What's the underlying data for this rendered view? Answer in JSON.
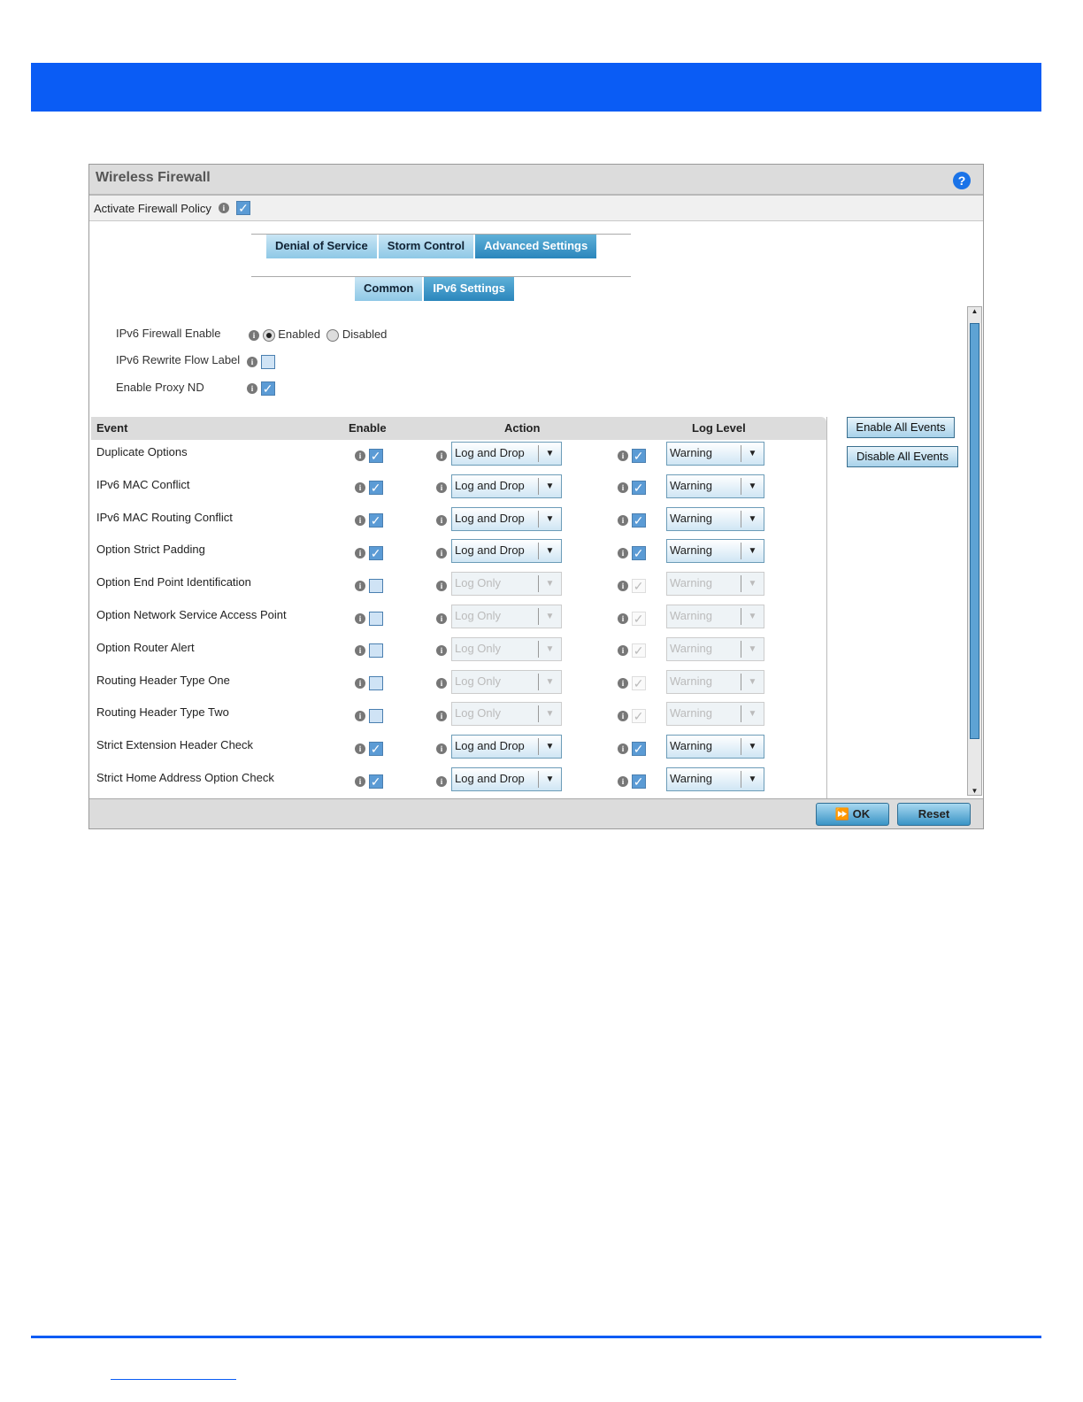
{
  "panel": {
    "title": "Wireless Firewall",
    "help": "?",
    "activate_label": "Activate Firewall Policy",
    "activate_checked": true
  },
  "tabs": [
    "Denial of Service",
    "Storm Control",
    "Advanced Settings"
  ],
  "subtabs": [
    "Common",
    "IPv6 Settings"
  ],
  "settings": {
    "fw_enable_label": "IPv6 Firewall Enable",
    "enabled": "Enabled",
    "disabled": "Disabled",
    "rewrite_label": "IPv6 Rewrite Flow Label",
    "proxy_label": "Enable Proxy ND"
  },
  "table": {
    "headers": [
      "Event",
      "Enable",
      "Action",
      "Log Level"
    ],
    "rows": [
      {
        "event": "Duplicate Options",
        "enabled": true,
        "action": "Log and Drop",
        "log": true,
        "level": "Warning"
      },
      {
        "event": "IPv6 MAC Conflict",
        "enabled": true,
        "action": "Log and Drop",
        "log": true,
        "level": "Warning"
      },
      {
        "event": "IPv6 MAC Routing Conflict",
        "enabled": true,
        "action": "Log and Drop",
        "log": true,
        "level": "Warning"
      },
      {
        "event": "Option Strict Padding",
        "enabled": true,
        "action": "Log and Drop",
        "log": true,
        "level": "Warning"
      },
      {
        "event": "Option End Point Identification",
        "enabled": false,
        "action": "Log Only",
        "log": true,
        "level": "Warning"
      },
      {
        "event": "Option Network Service Access Point",
        "enabled": false,
        "action": "Log Only",
        "log": true,
        "level": "Warning"
      },
      {
        "event": "Option Router Alert",
        "enabled": false,
        "action": "Log Only",
        "log": true,
        "level": "Warning"
      },
      {
        "event": "Routing Header Type One",
        "enabled": false,
        "action": "Log Only",
        "log": true,
        "level": "Warning"
      },
      {
        "event": "Routing Header Type Two",
        "enabled": false,
        "action": "Log Only",
        "log": true,
        "level": "Warning"
      },
      {
        "event": "Strict Extension Header Check",
        "enabled": true,
        "action": "Log and Drop",
        "log": true,
        "level": "Warning"
      },
      {
        "event": "Strict Home Address Option Check",
        "enabled": true,
        "action": "Log and Drop",
        "log": true,
        "level": "Warning"
      }
    ]
  },
  "buttons": {
    "enable_all": "Enable All Events",
    "disable_all": "Disable All Events",
    "ok": "OK",
    "reset": "Reset"
  }
}
